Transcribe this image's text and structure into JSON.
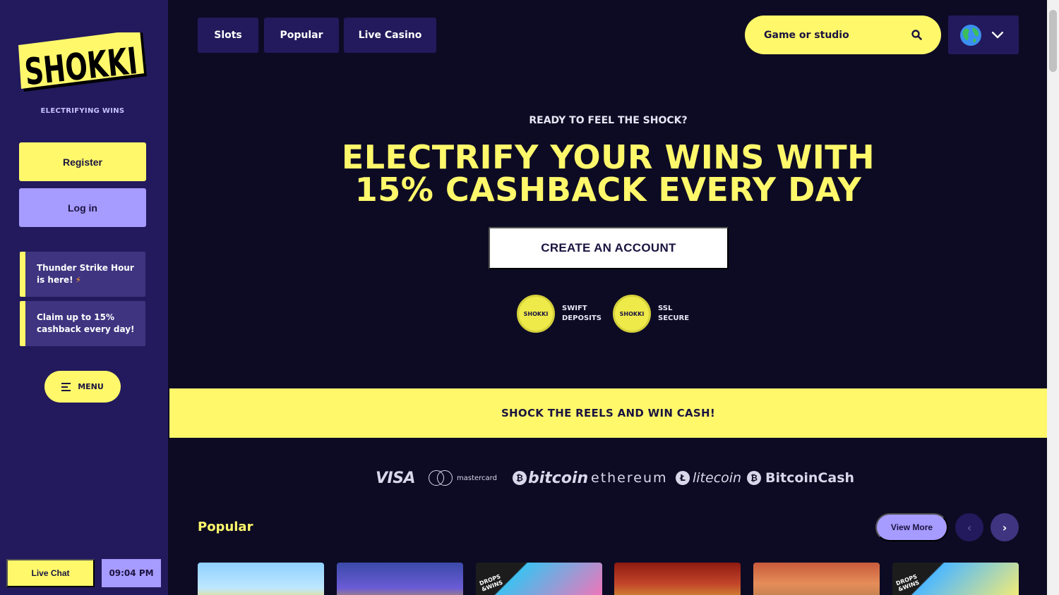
{
  "brand": {
    "logo_text": "SHOKKI",
    "tagline": "ELECTRIFYING WINS"
  },
  "sidebar": {
    "register_label": "Register",
    "login_label": "Log in",
    "promos": [
      {
        "text": "Thunder Strike Hour is here!",
        "emoji": "⚡"
      },
      {
        "text": "Claim up to 15% cashback every day!"
      }
    ],
    "menu_label": "MENU",
    "live_chat_label": "Live Chat",
    "clock": "09:04 PM"
  },
  "nav": {
    "tabs": [
      {
        "label": "Slots"
      },
      {
        "label": "Popular"
      },
      {
        "label": "Live Casino"
      }
    ],
    "search_placeholder": "Game or studio"
  },
  "hero": {
    "kicker": "READY TO FEEL THE SHOCK?",
    "title_line1": "ELECTRIFY YOUR WINS WITH",
    "title_line2": "15% CASHBACK EVERY DAY",
    "cta_label": "CREATE AN ACCOUNT",
    "badges": [
      {
        "coin_text": "SHOKKI",
        "line1": "SWIFT",
        "line2": "DEPOSITS"
      },
      {
        "coin_text": "SHOKKI",
        "line1": "SSL",
        "line2": "SECURE"
      }
    ]
  },
  "strip": {
    "text": "SHOCK THE REELS AND WIN CASH!"
  },
  "payments": [
    {
      "name": "VISA"
    },
    {
      "name": "mastercard"
    },
    {
      "name": "bitcoin",
      "symbol": "₿"
    },
    {
      "name": "ethereum"
    },
    {
      "name": "litecoin",
      "symbol": "Ł"
    },
    {
      "name": "BitcoinCash",
      "symbol": "₿"
    }
  ],
  "popular": {
    "title": "Popular",
    "view_more_label": "View More",
    "prev_icon": "‹",
    "next_icon": "›",
    "drops_badge_line1": "DROPS",
    "drops_badge_line2": "&WINS"
  },
  "colors": {
    "accent_yellow": "#fff86b",
    "accent_purple": "#a69bff",
    "sidebar_bg": "#221a5c",
    "page_bg": "#0d0b24"
  }
}
